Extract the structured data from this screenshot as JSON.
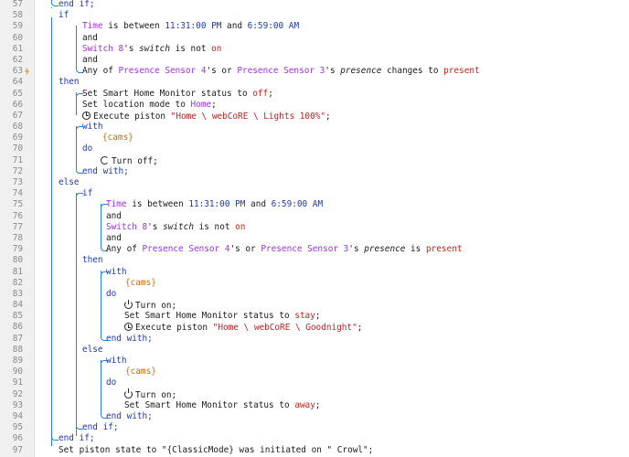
{
  "lines": {
    "l57": {
      "num": "57",
      "end": "end if;"
    },
    "l58": {
      "num": "58",
      "kw": "if"
    },
    "l59": {
      "num": "59",
      "a": "Time",
      "b": " is between ",
      "c": "11:31:00 PM",
      "d": " and ",
      "e": "6:59:00 AM"
    },
    "l60": {
      "num": "60",
      "kw": "and"
    },
    "l61": {
      "num": "61",
      "a": "Switch 8",
      "b": "'s ",
      "c": "switch",
      "d": " is not ",
      "e": "on"
    },
    "l62": {
      "num": "62",
      "kw": "and"
    },
    "l63": {
      "num": "63",
      "a": "Any of ",
      "b": "Presence Sensor 4",
      "c": "'s or ",
      "d": "Presence Sensor 3",
      "e": "'s ",
      "f": "presence",
      "g": " changes to ",
      "h": "present"
    },
    "l64": {
      "num": "64",
      "kw": "then"
    },
    "l65": {
      "num": "65",
      "a": "Set Smart Home Monitor status to ",
      "b": "off",
      "c": ";"
    },
    "l66": {
      "num": "66",
      "a": "Set location mode to ",
      "b": "Home",
      "c": ";"
    },
    "l67": {
      "num": "67",
      "a": "Execute piston ",
      "b": "\"Home \\ webCoRE \\ Lights 100%\"",
      "c": ";"
    },
    "l68": {
      "num": "68",
      "kw": "with"
    },
    "l69": {
      "num": "69",
      "v": "{cams}"
    },
    "l70": {
      "num": "70",
      "kw": "do"
    },
    "l71": {
      "num": "71",
      "a": "Turn off;"
    },
    "l72": {
      "num": "72",
      "kw": "end with;"
    },
    "l73": {
      "num": "73",
      "kw": "else"
    },
    "l74": {
      "num": "74",
      "kw": "if"
    },
    "l75": {
      "num": "75",
      "a": "Time",
      "b": " is between ",
      "c": "11:31:00 PM",
      "d": " and ",
      "e": "6:59:00 AM"
    },
    "l76": {
      "num": "76",
      "kw": "and"
    },
    "l77": {
      "num": "77",
      "a": "Switch 8",
      "b": "'s ",
      "c": "switch",
      "d": " is not ",
      "e": "on"
    },
    "l78": {
      "num": "78",
      "kw": "and"
    },
    "l79": {
      "num": "79",
      "a": "Any of ",
      "b": "Presence Sensor 4",
      "c": "'s or ",
      "d": "Presence Sensor 3",
      "e": "'s ",
      "f": "presence",
      "g": " is ",
      "h": "present"
    },
    "l80": {
      "num": "80",
      "kw": "then"
    },
    "l81": {
      "num": "81",
      "kw": "with"
    },
    "l82": {
      "num": "82",
      "v": "{cams}"
    },
    "l83": {
      "num": "83",
      "kw": "do"
    },
    "l84": {
      "num": "84",
      "a": "Turn on;"
    },
    "l85": {
      "num": "85",
      "a": "Set Smart Home Monitor status to ",
      "b": "stay",
      "c": ";"
    },
    "l86": {
      "num": "86",
      "a": "Execute piston ",
      "b": "\"Home \\ webCoRE \\ Goodnight\"",
      "c": ";"
    },
    "l87": {
      "num": "87",
      "kw": "end with;"
    },
    "l88": {
      "num": "88",
      "kw": "else"
    },
    "l89": {
      "num": "89",
      "kw": "with"
    },
    "l90": {
      "num": "90",
      "v": "{cams}"
    },
    "l91": {
      "num": "91",
      "kw": "do"
    },
    "l92": {
      "num": "92",
      "a": "Turn on;"
    },
    "l93": {
      "num": "93",
      "a": "Set Smart Home Monitor status to ",
      "b": "away",
      "c": ";"
    },
    "l94": {
      "num": "94",
      "kw": "end with;"
    },
    "l95": {
      "num": "95",
      "kw": "end if;"
    },
    "l96": {
      "num": "96",
      "kw": "end if;"
    },
    "l97": {
      "num": "97",
      "a": "Set piston state to \"{ClassicMode} was initiated on \" Crowl\";"
    }
  },
  "colors": {
    "keyword": "#1f3aa6",
    "device": "#9a35d6",
    "value": "#c0281c",
    "string": "#b3262a",
    "variable": "#c26d17",
    "bracket": "#2f7fd6"
  }
}
